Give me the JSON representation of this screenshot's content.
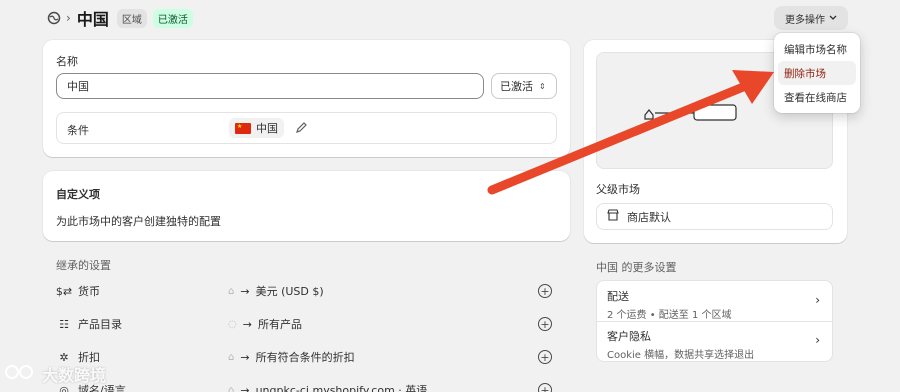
{
  "header": {
    "title": "中国",
    "badge_region": "区域",
    "badge_status": "已激活",
    "more_actions": "更多操作"
  },
  "dropdown": {
    "items": [
      "编辑市场名称",
      "删除市场",
      "查看在线商店"
    ]
  },
  "name_card": {
    "label": "名称",
    "value": "中国",
    "status_select": "已激活",
    "condition_label": "条件",
    "condition_value": "中国"
  },
  "custom_card": {
    "title": "自定义项",
    "description": "为此市场中的客户创建独特的配置"
  },
  "inherited": {
    "heading": "继承的设置",
    "rows": [
      {
        "label": "货币",
        "value": "美元 (USD $)"
      },
      {
        "label": "产品目录",
        "value": "所有产品"
      },
      {
        "label": "折扣",
        "value": "所有符合条件的折扣"
      },
      {
        "label": "域名/语言",
        "value": "ungpkc-ci.myshopify.com · 英语"
      }
    ]
  },
  "parent_card": {
    "parent_label": "父级市场",
    "store_default": "商店默认"
  },
  "more_settings": {
    "heading": "中国 的更多设置",
    "shipping_title": "配送",
    "shipping_sub": "2 个运费 • 配送至 1 个区域",
    "privacy_title": "客户隐私",
    "privacy_sub": "Cookie 横幅，数据共享选择退出"
  },
  "watermark": "大数跨境",
  "colors": {
    "arrow": "#e8472a",
    "badge_green_bg": "#cdfee1",
    "danger_text": "#8e1f0b"
  }
}
